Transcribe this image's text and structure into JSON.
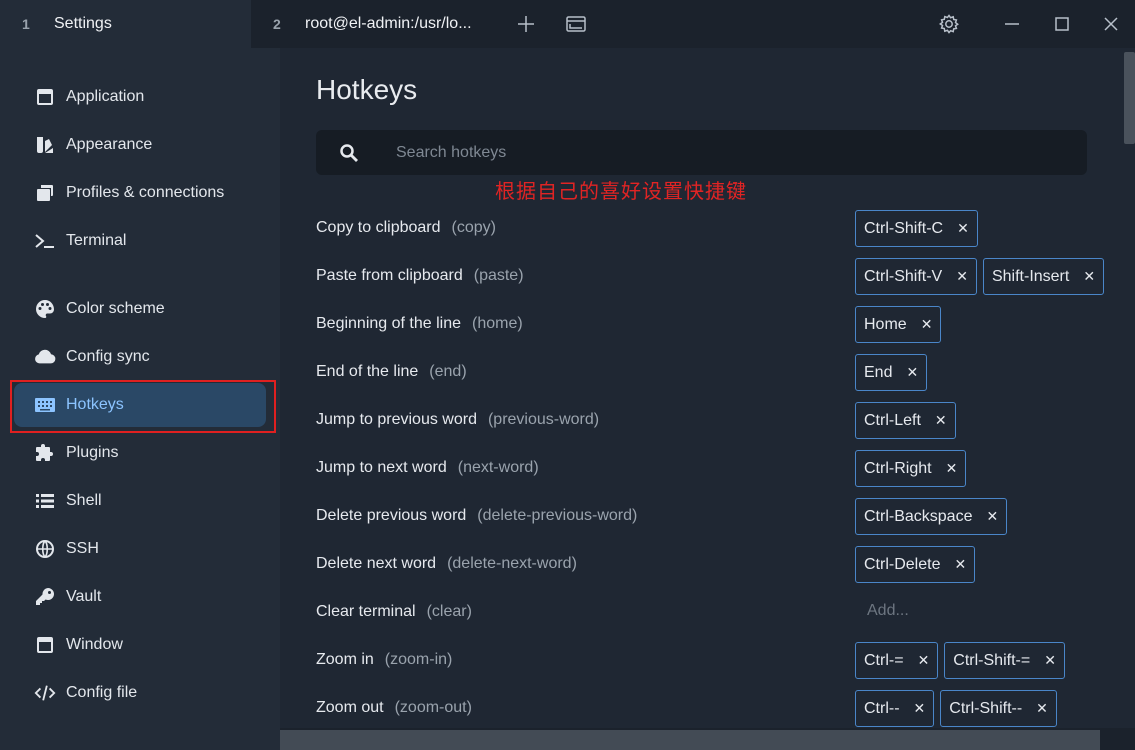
{
  "tabs": [
    {
      "num": "1",
      "title": "Settings"
    },
    {
      "num": "2",
      "title": "root@el-admin:/usr/lo..."
    }
  ],
  "titlebar_icons": [
    "plus-icon",
    "window-icon",
    "gear-icon",
    "minimize-icon",
    "maximize-icon",
    "close-icon"
  ],
  "sidebar": {
    "items": [
      {
        "label": "Application",
        "icon": "application-icon"
      },
      {
        "label": "Appearance",
        "icon": "appearance-icon"
      },
      {
        "label": "Profiles & connections",
        "icon": "profiles-icon"
      },
      {
        "label": "Terminal",
        "icon": "terminal-icon"
      },
      {
        "label": "Color scheme",
        "icon": "palette-icon"
      },
      {
        "label": "Config sync",
        "icon": "cloud-icon"
      },
      {
        "label": "Hotkeys",
        "icon": "keyboard-icon",
        "active": true
      },
      {
        "label": "Plugins",
        "icon": "puzzle-icon"
      },
      {
        "label": "Shell",
        "icon": "list-icon"
      },
      {
        "label": "SSH",
        "icon": "globe-icon"
      },
      {
        "label": "Vault",
        "icon": "key-icon"
      },
      {
        "label": "Window",
        "icon": "window-icon"
      },
      {
        "label": "Config file",
        "icon": "code-icon"
      }
    ]
  },
  "main": {
    "title": "Hotkeys",
    "search_placeholder": "Search hotkeys",
    "annotation": "根据自己的喜好设置快捷键",
    "add_label": "Add...",
    "hotkeys": [
      {
        "label": "Copy to clipboard",
        "id": "(copy)",
        "keys": [
          "Ctrl-Shift-C"
        ]
      },
      {
        "label": "Paste from clipboard",
        "id": "(paste)",
        "keys": [
          "Ctrl-Shift-V",
          "Shift-Insert"
        ]
      },
      {
        "label": "Beginning of the line",
        "id": "(home)",
        "keys": [
          "Home"
        ]
      },
      {
        "label": "End of the line",
        "id": "(end)",
        "keys": [
          "End"
        ]
      },
      {
        "label": "Jump to previous word",
        "id": "(previous-word)",
        "keys": [
          "Ctrl-Left"
        ]
      },
      {
        "label": "Jump to next word",
        "id": "(next-word)",
        "keys": [
          "Ctrl-Right"
        ]
      },
      {
        "label": "Delete previous word",
        "id": "(delete-previous-word)",
        "keys": [
          "Ctrl-Backspace"
        ]
      },
      {
        "label": "Delete next word",
        "id": "(delete-next-word)",
        "keys": [
          "Ctrl-Delete"
        ]
      },
      {
        "label": "Clear terminal",
        "id": "(clear)",
        "keys": []
      },
      {
        "label": "Zoom in",
        "id": "(zoom-in)",
        "keys": [
          "Ctrl-=",
          "Ctrl-Shift-="
        ]
      },
      {
        "label": "Zoom out",
        "id": "(zoom-out)",
        "keys": [
          "Ctrl--",
          "Ctrl-Shift--"
        ]
      }
    ]
  },
  "colors": {
    "accent": "#4a86c9",
    "active_bg": "#2a4866",
    "annotation": "#e02424",
    "highlight_box": "#e02020"
  }
}
